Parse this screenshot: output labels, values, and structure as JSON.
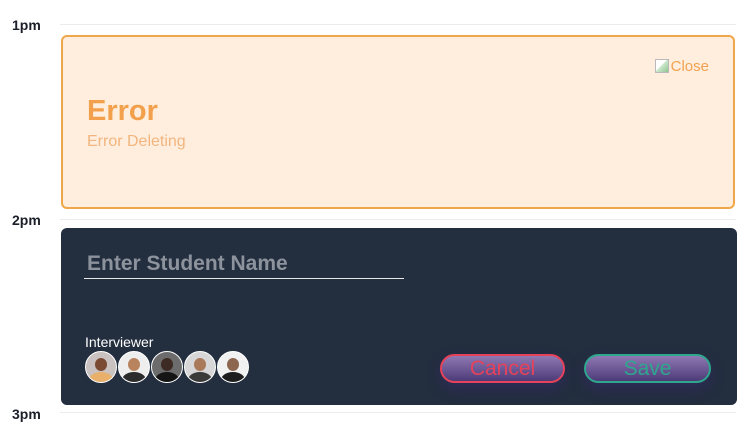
{
  "timeline": {
    "labels": [
      "1pm",
      "2pm",
      "3pm"
    ]
  },
  "error": {
    "title": "Error",
    "message": "Error Deleting",
    "close_alt": "Close"
  },
  "editor": {
    "student_placeholder": "Enter Student Name",
    "student_value": "",
    "interviewer_label": "Interviewer",
    "avatars": [
      {
        "name": "interviewer-avatar-1",
        "skin": "#7a4a33",
        "shirt": "#e8b06a",
        "bg": "#c9c2c0"
      },
      {
        "name": "interviewer-avatar-2",
        "skin": "#b9845d",
        "shirt": "#2b2b2b",
        "bg": "#eeeeee"
      },
      {
        "name": "interviewer-avatar-3",
        "skin": "#3d2a22",
        "shirt": "#151515",
        "bg": "#6c6c6c"
      },
      {
        "name": "interviewer-avatar-4",
        "skin": "#a9795a",
        "shirt": "#3a3a3a",
        "bg": "#d7d7d7"
      },
      {
        "name": "interviewer-avatar-5",
        "skin": "#8d6650",
        "shirt": "#1d1d1d",
        "bg": "#f1f1f1"
      }
    ],
    "cancel_label": "Cancel",
    "save_label": "Save"
  },
  "colors": {
    "error_accent": "#f3a04d",
    "error_bg": "#ffeedd",
    "editor_bg": "#232e3f",
    "cancel": "#e6425a",
    "save": "#2fa68e"
  }
}
